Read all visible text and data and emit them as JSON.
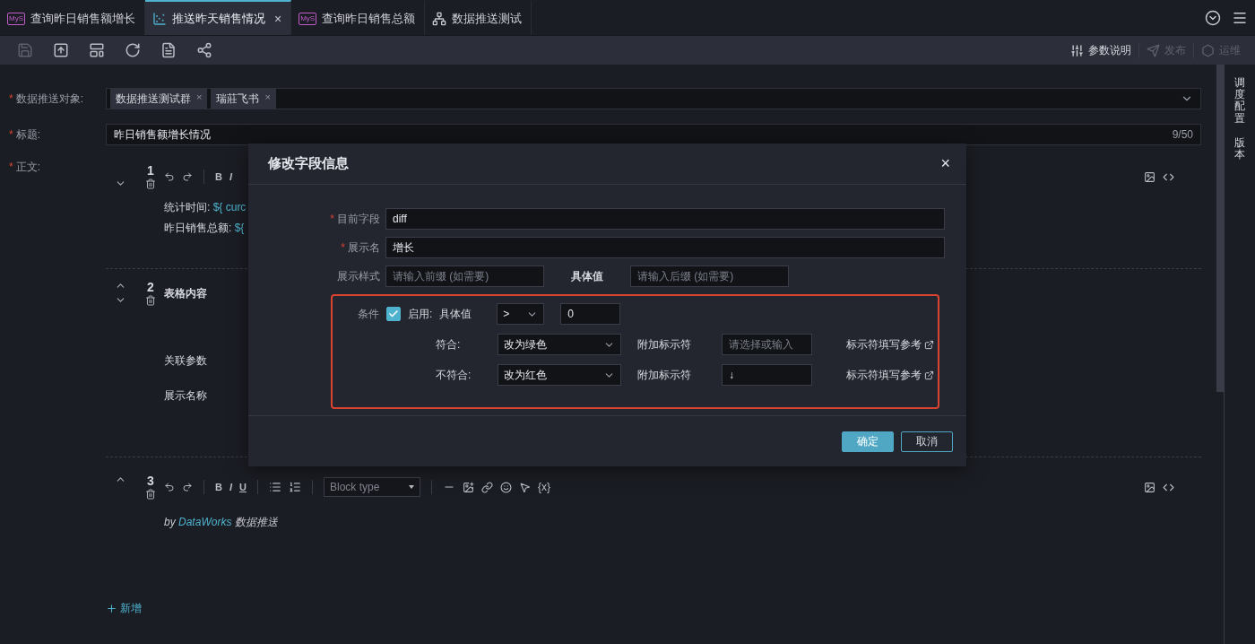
{
  "tabs": [
    {
      "label": "查询昨日销售额增长",
      "kind": "mysql",
      "badge": "MyS",
      "selected": false
    },
    {
      "label": "推送昨天销售情况",
      "kind": "chart",
      "selected": true,
      "close": "×"
    },
    {
      "label": "查询昨日销售总额",
      "kind": "mysql",
      "badge": "MyS",
      "selected": false
    },
    {
      "label": "数据推送测试",
      "kind": "tree",
      "selected": false
    }
  ],
  "toolbar": {
    "tools": [
      {
        "kind": "save",
        "disabled": true
      },
      {
        "kind": "submit",
        "disabled": false
      },
      {
        "kind": "layout",
        "disabled": false
      },
      {
        "kind": "refresh",
        "disabled": false
      },
      {
        "kind": "check",
        "disabled": false
      },
      {
        "kind": "graph",
        "disabled": false
      }
    ],
    "actions": [
      {
        "kind": "params",
        "label": "参数说明",
        "disabled": false
      },
      {
        "kind": "publish",
        "label": "发布",
        "disabled": true
      },
      {
        "kind": "ops",
        "label": "运维",
        "disabled": true
      }
    ]
  },
  "form": {
    "recipients": {
      "label": "数据推送对象:",
      "mark": "*",
      "tags": [
        {
          "label": "数据推送测试群",
          "remove": "×"
        },
        {
          "label": "瑞莊飞书",
          "remove": "×"
        }
      ]
    },
    "title": {
      "label": "标题:",
      "mark": "*",
      "value": "昨日销售额增长情况",
      "counter": "9/50"
    },
    "body": {
      "label": "正文:",
      "mark": "*",
      "blocks": [
        {
          "kind": "text",
          "number": "1",
          "move_up": false,
          "move_down": true,
          "format": [
            "B",
            "I"
          ],
          "side_tools": true,
          "lines": [
            {
              "label": "统计时间:",
              "variable": "${ curc"
            },
            {
              "label": "昨日销售总额:",
              "variable": "${"
            }
          ]
        },
        {
          "kind": "table",
          "number": "2",
          "move_up": true,
          "move_down": true,
          "title": "表格内容",
          "rows": [
            "关联参数",
            "展示名称"
          ]
        },
        {
          "kind": "text",
          "number": "3",
          "move_up": true,
          "move_down": false,
          "format": [
            "B",
            "I",
            "U"
          ],
          "block_type": "Block type",
          "insert": "{x}",
          "side_tools": true,
          "footer": {
            "prefix": "by",
            "link": "DataWorks",
            "suffix": "数据推送"
          }
        }
      ]
    },
    "add": "新增"
  },
  "rail": [
    "调度配置",
    "版本"
  ],
  "modal": {
    "title": "修改字段信息",
    "close": "×",
    "fields": [
      {
        "label": "目前字段",
        "mark": "*",
        "value": "diff"
      },
      {
        "label": "展示名",
        "mark": "*",
        "value": "增长"
      }
    ],
    "style_row": {
      "label": "展示样式",
      "prefix_placeholder": "请输入前缀 (如需要)",
      "middle": "具体值",
      "suffix_placeholder": "请输入后缀 (如需要)"
    },
    "condition": {
      "label": "条件",
      "enabled": true,
      "enable_label": "启用:",
      "value_label": "具体值",
      "operator": ">",
      "threshold": "0",
      "outcomes": [
        {
          "label": "符合:",
          "action": "改为绿色",
          "marker_label": "附加标示符",
          "marker_placeholder": "请选择或输入",
          "help": "标示符填写参考"
        },
        {
          "label": "不符合:",
          "action": "改为红色",
          "marker_label": "附加标示符",
          "marker_value": "↓",
          "help": "标示符填写参考"
        }
      ]
    },
    "buttons": [
      {
        "label": "确定",
        "kind": "primary"
      },
      {
        "label": "取消",
        "kind": "secondary"
      }
    ]
  }
}
